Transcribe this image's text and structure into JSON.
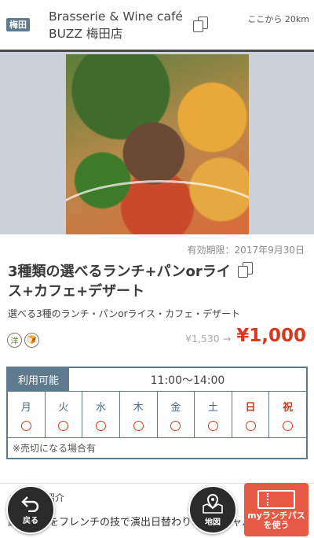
{
  "header": {
    "area_badge": "梅田",
    "shop_name": "Brasserie & Wine café BUZZ 梅田店",
    "distance": "ここから 20km"
  },
  "coupon": {
    "expiry": "有効期限：2017年9月30日",
    "title": "3種類の選べるランチ+パンorライス+カフェ+デザート",
    "subtitle": "選べる3種のランチ・パンorライス・カフェ・デザート",
    "tags": [
      "洋",
      "🍞"
    ],
    "price_old": "¥1,530 →",
    "price_new": "¥1,000"
  },
  "schedule": {
    "available_label": "利用可能",
    "hours": "11:00〜14:00",
    "days": [
      {
        "name": "月",
        "holiday": false
      },
      {
        "name": "火",
        "holiday": false
      },
      {
        "name": "水",
        "holiday": false
      },
      {
        "name": "木",
        "holiday": false
      },
      {
        "name": "金",
        "holiday": false
      },
      {
        "name": "土",
        "holiday": false
      },
      {
        "name": "日",
        "holiday": true
      },
      {
        "name": "祝",
        "holiday": true
      }
    ],
    "note": "※売切になる場合有"
  },
  "intro": {
    "title": "メニュー紹介",
    "text": "厳選素材をフレンチの技で演出日替わりのスペシャルランチ"
  },
  "nav": {
    "back_label": "戻る",
    "map_label": "地図",
    "mypass_label": "myランチパス\nを使う"
  },
  "colors": {
    "accent": "#5f7a8c",
    "price_red": "#d9381e",
    "mypass": "#e65a45"
  }
}
